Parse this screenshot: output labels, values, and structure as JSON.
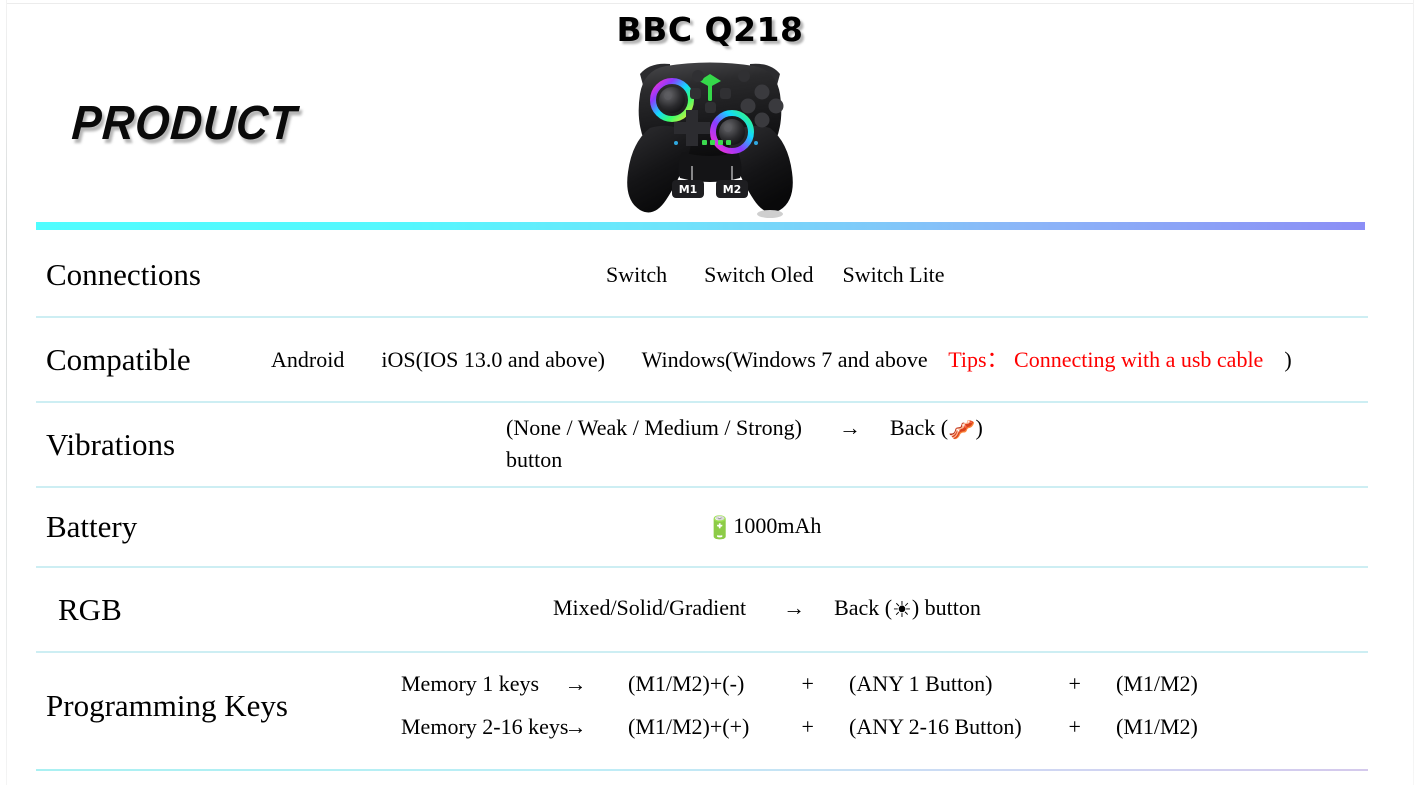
{
  "header": {
    "section_word": "PRODUCT",
    "model_title": "BBC Q218",
    "hero_alt": "game-controller-product-photo",
    "hero_button_m1": "M1",
    "hero_button_m2": "M2"
  },
  "colors": {
    "accent_gradient_start": "#4FFDFF",
    "accent_gradient_end": "#8B8EF6",
    "row_divider": "#CDEEF3",
    "tips_red": "#FF0000",
    "battery_green": "#3FC02F",
    "vibration_orange": "#E2662C"
  },
  "spec_table": {
    "rows": [
      {
        "label": "Connections",
        "values": [
          "Switch",
          "Switch Oled",
          "Switch Lite"
        ]
      },
      {
        "label": "Compatible",
        "android": "Android",
        "ios": "iOS(IOS 13.0 and above)",
        "windows_prefix": "Windows(Windows 7 and above",
        "tips": "Tips：  Connecting with a usb cable",
        "windows_suffix": ")"
      },
      {
        "label": "Vibrations",
        "modes": "(None / Weak / Medium / Strong)",
        "arrow": "→",
        "back_prefix": "Back (",
        "back_icon": "vibration-icon",
        "back_suffix": ")",
        "button_word": "button"
      },
      {
        "label": "Battery",
        "icon": "battery-icon",
        "capacity": "1000mAh"
      },
      {
        "label": "RGB",
        "modes": "Mixed/Solid/Gradient",
        "arrow": "→",
        "back_prefix": "Back (",
        "back_icon": "sun-brightness-icon",
        "back_suffix": ") button"
      },
      {
        "label": "Programming Keys",
        "lines": [
          {
            "memory": "Memory 1 keys",
            "arrow": "→",
            "combo1": "(M1/M2)+(-)",
            "plus1": "+",
            "combo2": "(ANY 1 Button)",
            "plus2": "+",
            "combo3": "(M1/M2)"
          },
          {
            "memory": "Memory 2-16 keys",
            "arrow": "→",
            "combo1": "(M1/M2)+(+)",
            "plus1": "+",
            "combo2": "(ANY 2-16 Button)",
            "plus2": "+",
            "combo3": "(M1/M2)"
          }
        ]
      }
    ]
  }
}
